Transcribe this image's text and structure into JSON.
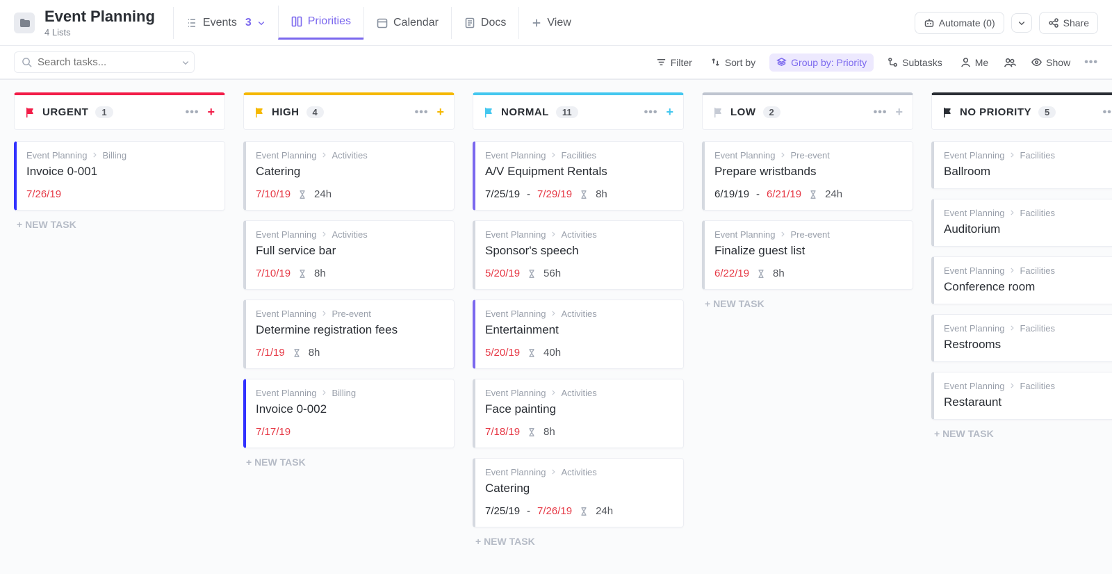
{
  "header": {
    "title": "Event Planning",
    "subtitle": "4 Lists",
    "tabs": {
      "events": {
        "label": "Events",
        "count": "3"
      },
      "priorities": {
        "label": "Priorities"
      },
      "calendar": {
        "label": "Calendar"
      },
      "docs": {
        "label": "Docs"
      },
      "addview": {
        "label": "View"
      }
    },
    "automate": "Automate (0)",
    "share": "Share"
  },
  "toolbar": {
    "search_placeholder": "Search tasks...",
    "filter": "Filter",
    "sort": "Sort by",
    "group": "Group by: Priority",
    "subtasks": "Subtasks",
    "me": "Me",
    "show": "Show"
  },
  "new_task_label": "+ NEW TASK",
  "columns": [
    {
      "id": "urgent",
      "title": "URGENT",
      "count": "1",
      "flag": "urgent",
      "cards": [
        {
          "folder": "Event Planning",
          "list": "Billing",
          "title": "Invoice 0-001",
          "date1": "7/26/19",
          "date1_red": true,
          "accent": "blue"
        }
      ]
    },
    {
      "id": "high",
      "title": "HIGH",
      "count": "4",
      "flag": "high",
      "cards": [
        {
          "folder": "Event Planning",
          "list": "Activities",
          "title": "Catering",
          "date1": "7/10/19",
          "date1_red": true,
          "estimate": "24h",
          "accent": "grey"
        },
        {
          "folder": "Event Planning",
          "list": "Activities",
          "title": "Full service bar",
          "date1": "7/10/19",
          "date1_red": true,
          "estimate": "8h",
          "accent": "grey"
        },
        {
          "folder": "Event Planning",
          "list": "Pre-event",
          "title": "Determine registration fees",
          "date1": "7/1/19",
          "date1_red": true,
          "estimate": "8h",
          "accent": "grey"
        },
        {
          "folder": "Event Planning",
          "list": "Billing",
          "title": "Invoice 0-002",
          "date1": "7/17/19",
          "date1_red": true,
          "accent": "blue"
        }
      ]
    },
    {
      "id": "normal",
      "title": "NORMAL",
      "count": "11",
      "flag": "normal",
      "cards": [
        {
          "folder": "Event Planning",
          "list": "Facilities",
          "title": "A/V Equipment Rentals",
          "date1": "7/25/19",
          "date2": "7/29/19",
          "date1_red": false,
          "estimate": "8h",
          "accent": "purple"
        },
        {
          "folder": "Event Planning",
          "list": "Activities",
          "title": "Sponsor's speech",
          "date1": "5/20/19",
          "date1_red": true,
          "estimate": "56h",
          "accent": "grey"
        },
        {
          "folder": "Event Planning",
          "list": "Activities",
          "title": "Entertainment",
          "date1": "5/20/19",
          "date1_red": true,
          "estimate": "40h",
          "accent": "purple"
        },
        {
          "folder": "Event Planning",
          "list": "Activities",
          "title": "Face painting",
          "date1": "7/18/19",
          "date1_red": true,
          "estimate": "8h",
          "accent": "grey"
        },
        {
          "folder": "Event Planning",
          "list": "Activities",
          "title": "Catering",
          "date1": "7/25/19",
          "date2": "7/26/19",
          "date1_red": false,
          "estimate": "24h",
          "accent": "grey"
        }
      ]
    },
    {
      "id": "low",
      "title": "LOW",
      "count": "2",
      "flag": "low",
      "cards": [
        {
          "folder": "Event Planning",
          "list": "Pre-event",
          "title": "Prepare wristbands",
          "date1": "6/19/19",
          "date2": "6/21/19",
          "date1_red": false,
          "estimate": "24h",
          "accent": "grey"
        },
        {
          "folder": "Event Planning",
          "list": "Pre-event",
          "title": "Finalize guest list",
          "date1": "6/22/19",
          "date1_red": true,
          "estimate": "8h",
          "accent": "grey"
        }
      ]
    },
    {
      "id": "none",
      "title": "NO PRIORITY",
      "count": "5",
      "flag": "none",
      "cards": [
        {
          "folder": "Event Planning",
          "list": "Facilities",
          "title": "Ballroom",
          "accent": "grey"
        },
        {
          "folder": "Event Planning",
          "list": "Facilities",
          "title": "Auditorium",
          "accent": "grey"
        },
        {
          "folder": "Event Planning",
          "list": "Facilities",
          "title": "Conference room",
          "accent": "grey"
        },
        {
          "folder": "Event Planning",
          "list": "Facilities",
          "title": "Restrooms",
          "accent": "grey"
        },
        {
          "folder": "Event Planning",
          "list": "Facilities",
          "title": "Restaraunt",
          "accent": "grey"
        }
      ]
    }
  ]
}
